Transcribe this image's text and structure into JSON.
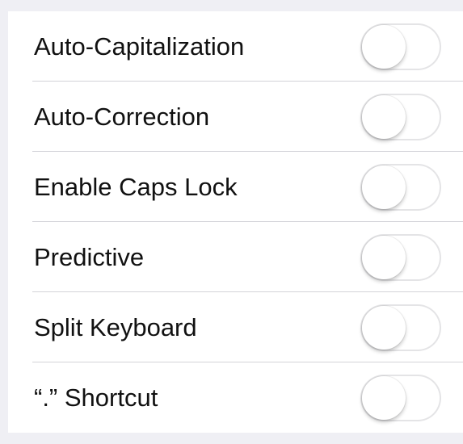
{
  "settings": {
    "items": [
      {
        "label": "Auto-Capitalization",
        "enabled": false
      },
      {
        "label": "Auto-Correction",
        "enabled": false
      },
      {
        "label": "Enable Caps Lock",
        "enabled": false
      },
      {
        "label": "Predictive",
        "enabled": false
      },
      {
        "label": "Split Keyboard",
        "enabled": false
      },
      {
        "label": "“.” Shortcut",
        "enabled": false
      }
    ]
  },
  "colors": {
    "background": "#efeff4",
    "cell": "#ffffff",
    "separator": "#d3d3d8",
    "toggle_border": "#e4e4e6",
    "toggle_on": "#4cd964"
  }
}
